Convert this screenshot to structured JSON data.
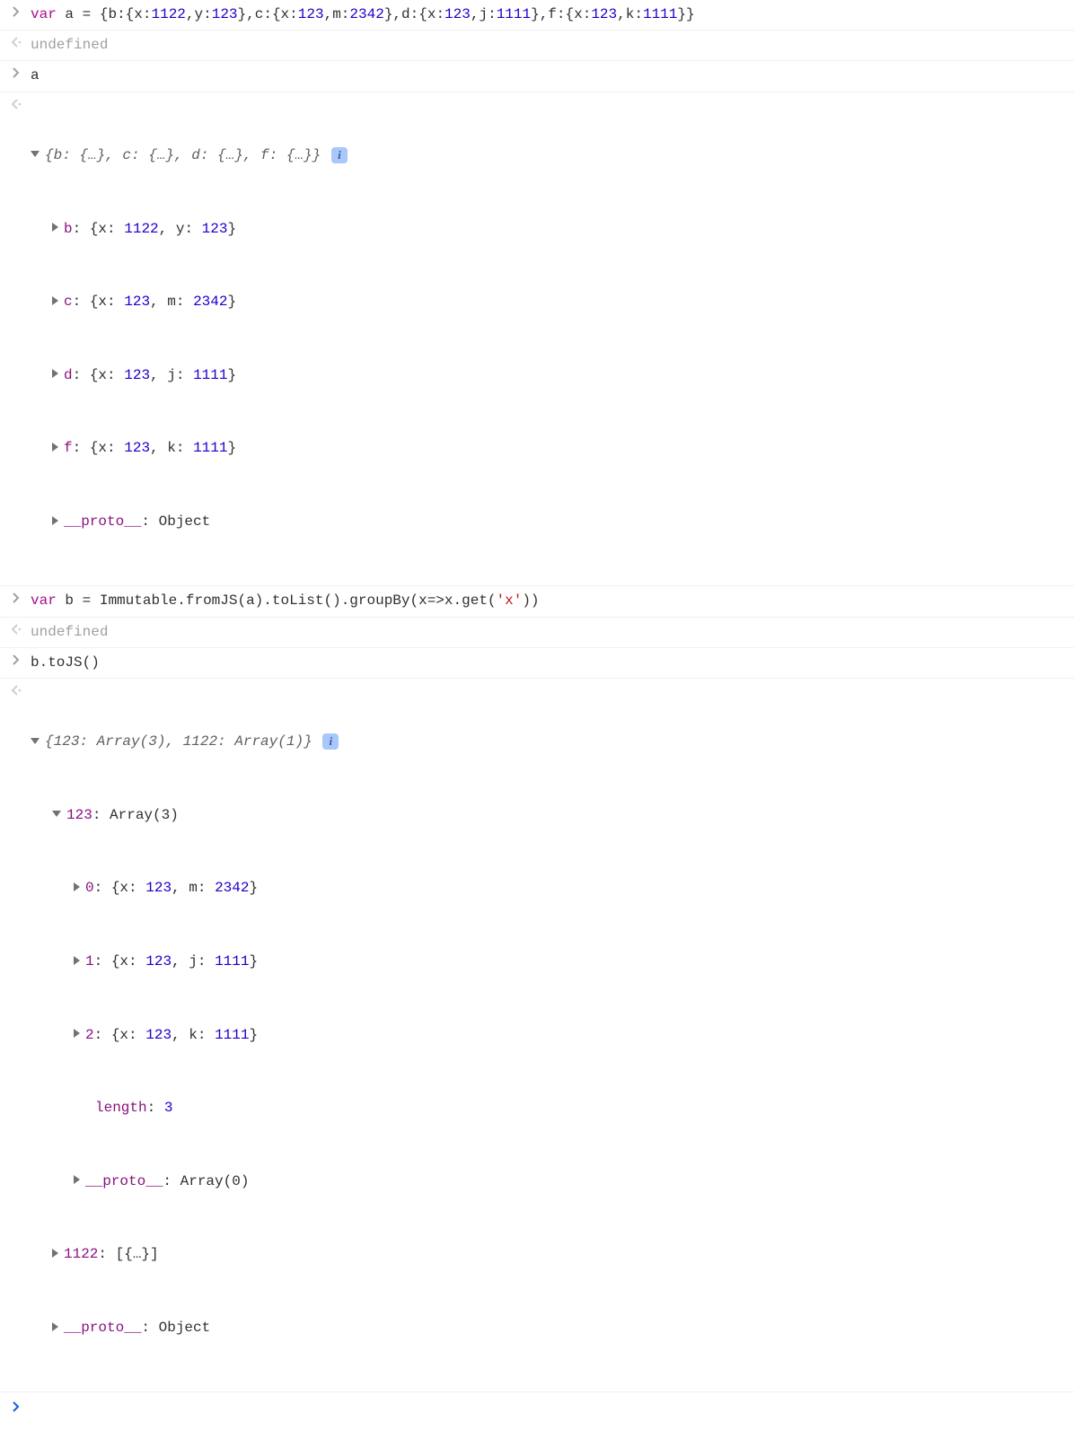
{
  "rows": {
    "r1": {
      "var": "var",
      "a": "a",
      "eq": " = ",
      "lb": "{",
      "b_key": "b",
      "b_open": ":{",
      "b_x": "x",
      "b_xv": "1122",
      "b_c1": ",",
      "b_y": "y",
      "b_yv": "123",
      "b_close": "},",
      "c_key": "c",
      "c_open": ":{",
      "c_x": "x",
      "c_xv": "123",
      "c_c1": ",",
      "c_m": "m",
      "c_mv": "2342",
      "c_close": "},",
      "d_key": "d",
      "d_open": ":{",
      "d_x": "x",
      "d_xv": "123",
      "d_c1": ",",
      "d_j": "j",
      "d_jv": "1111",
      "d_close": "},",
      "f_key": "f",
      "f_open": ":{",
      "f_x": "x",
      "f_xv": "123",
      "f_c1": ",",
      "f_k": "k",
      "f_kv": "1111",
      "f_close": "}",
      "rb": "}"
    },
    "r2": {
      "text": "undefined"
    },
    "r3": {
      "text": "a"
    },
    "r4": {
      "summary_open": "{",
      "s_b": "b: {…}",
      "s_c": ", ",
      "s_cv": "c: {…}",
      "s_d": ", ",
      "s_dv": "d: {…}",
      "s_f": ", ",
      "s_fv": "f: {…}",
      "summary_close": "}",
      "info": "i",
      "b_label": "b",
      "b_body_open": ": {",
      "b_x": "x",
      "b_xc": ": ",
      "b_xv": "1122",
      "b_sep": ", ",
      "b_y": "y",
      "b_yc": ": ",
      "b_yv": "123",
      "b_body_close": "}",
      "c_label": "c",
      "c_body_open": ": {",
      "c_x": "x",
      "c_xc": ": ",
      "c_xv": "123",
      "c_sep": ", ",
      "c_m": "m",
      "c_mc": ": ",
      "c_mv": "2342",
      "c_body_close": "}",
      "d_label": "d",
      "d_body_open": ": {",
      "d_x": "x",
      "d_xc": ": ",
      "d_xv": "123",
      "d_sep": ", ",
      "d_j": "j",
      "d_jc": ": ",
      "d_jv": "1111",
      "d_body_close": "}",
      "f_label": "f",
      "f_body_open": ": {",
      "f_x": "x",
      "f_xc": ": ",
      "f_xv": "123",
      "f_sep": ", ",
      "f_k": "k",
      "f_kc": ": ",
      "f_kv": "1111",
      "f_body_close": "}",
      "proto": "__proto__",
      "proto_v": ": Object"
    },
    "r5": {
      "var": "var",
      "b": "b",
      "eq": " = ",
      "imm": "Immutable.fromJS(a).toList().groupBy(x=>x.get(",
      "q": "'x'",
      "end": "))"
    },
    "r6": {
      "text": "undefined"
    },
    "r7": {
      "text": "b.toJS()"
    },
    "r8": {
      "summary_open": "{",
      "s_123": "123: Array(3)",
      "s_c": ", ",
      "s_1122": "1122: Array(1)",
      "summary_close": "}",
      "info": "i",
      "k123": "123",
      "k123v": ": Array(3)",
      "i0": "0",
      "i0_open": ": {",
      "i0_x": "x",
      "i0_xc": ": ",
      "i0_xv": "123",
      "i0_sep": ", ",
      "i0_m": "m",
      "i0_mc": ": ",
      "i0_mv": "2342",
      "i0_close": "}",
      "i1": "1",
      "i1_open": ": {",
      "i1_x": "x",
      "i1_xc": ": ",
      "i1_xv": "123",
      "i1_sep": ", ",
      "i1_j": "j",
      "i1_jc": ": ",
      "i1_jv": "1111",
      "i1_close": "}",
      "i2": "2",
      "i2_open": ": {",
      "i2_x": "x",
      "i2_xc": ": ",
      "i2_xv": "123",
      "i2_sep": ", ",
      "i2_k": "k",
      "i2_kc": ": ",
      "i2_kv": "1111",
      "i2_close": "}",
      "length_k": "length",
      "length_c": ": ",
      "length_v": "3",
      "proto_arr": "__proto__",
      "proto_arr_v": ": Array(0)",
      "k1122": "1122",
      "k1122v": ": [{…}]",
      "proto": "__proto__",
      "proto_v": ": Object"
    }
  }
}
